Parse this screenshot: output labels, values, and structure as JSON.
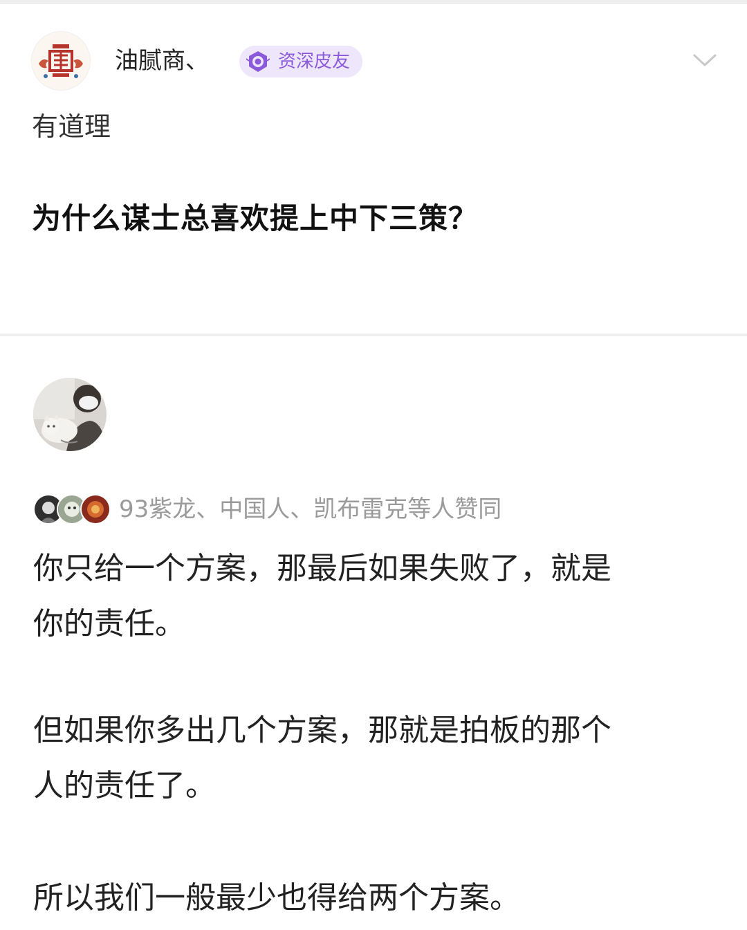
{
  "post": {
    "author_name": "油腻商、",
    "badge_label": "资深皮友",
    "comment": "有道理",
    "question_title": "为什么谋士总喜欢提上中下三策？"
  },
  "answer": {
    "likes_text": "93紫龙、中国人、凯布雷克等人赞同",
    "paragraphs": [
      {
        "lines": [
          "你只给一个方案，那最后如果失败了，就是",
          "你的责任。"
        ]
      },
      {
        "lines": [
          "但如果你多出几个方案，那就是拍板的那个",
          "人的责任了。"
        ]
      },
      {
        "lines": [
          "所以我们一般最少也得给两个方案。"
        ]
      }
    ]
  },
  "colors": {
    "badge_bg": "#eee6fb",
    "badge_text": "#8b5ad9",
    "secondary_text": "#9a9a9a"
  },
  "icons": [
    "seal-avatar-icon",
    "badge-emblem-icon",
    "chevron-down-icon",
    "user-photo-avatar",
    "liker-avatar-icon"
  ]
}
